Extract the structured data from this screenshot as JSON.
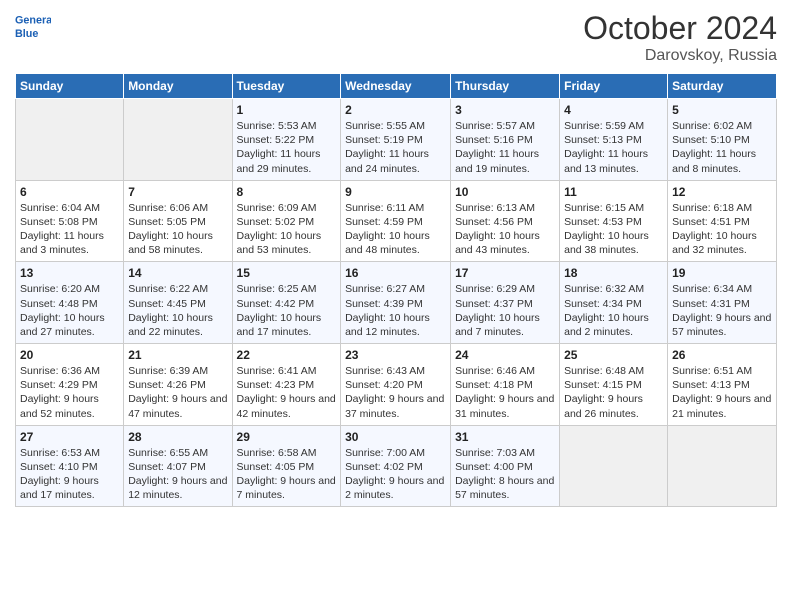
{
  "header": {
    "logo_line1": "General",
    "logo_line2": "Blue",
    "month_year": "October 2024",
    "location": "Darovskoy, Russia"
  },
  "weekdays": [
    "Sunday",
    "Monday",
    "Tuesday",
    "Wednesday",
    "Thursday",
    "Friday",
    "Saturday"
  ],
  "weeks": [
    [
      {
        "day": "",
        "info": ""
      },
      {
        "day": "",
        "info": ""
      },
      {
        "day": "1",
        "info": "Sunrise: 5:53 AM\nSunset: 5:22 PM\nDaylight: 11 hours and 29 minutes."
      },
      {
        "day": "2",
        "info": "Sunrise: 5:55 AM\nSunset: 5:19 PM\nDaylight: 11 hours and 24 minutes."
      },
      {
        "day": "3",
        "info": "Sunrise: 5:57 AM\nSunset: 5:16 PM\nDaylight: 11 hours and 19 minutes."
      },
      {
        "day": "4",
        "info": "Sunrise: 5:59 AM\nSunset: 5:13 PM\nDaylight: 11 hours and 13 minutes."
      },
      {
        "day": "5",
        "info": "Sunrise: 6:02 AM\nSunset: 5:10 PM\nDaylight: 11 hours and 8 minutes."
      }
    ],
    [
      {
        "day": "6",
        "info": "Sunrise: 6:04 AM\nSunset: 5:08 PM\nDaylight: 11 hours and 3 minutes."
      },
      {
        "day": "7",
        "info": "Sunrise: 6:06 AM\nSunset: 5:05 PM\nDaylight: 10 hours and 58 minutes."
      },
      {
        "day": "8",
        "info": "Sunrise: 6:09 AM\nSunset: 5:02 PM\nDaylight: 10 hours and 53 minutes."
      },
      {
        "day": "9",
        "info": "Sunrise: 6:11 AM\nSunset: 4:59 PM\nDaylight: 10 hours and 48 minutes."
      },
      {
        "day": "10",
        "info": "Sunrise: 6:13 AM\nSunset: 4:56 PM\nDaylight: 10 hours and 43 minutes."
      },
      {
        "day": "11",
        "info": "Sunrise: 6:15 AM\nSunset: 4:53 PM\nDaylight: 10 hours and 38 minutes."
      },
      {
        "day": "12",
        "info": "Sunrise: 6:18 AM\nSunset: 4:51 PM\nDaylight: 10 hours and 32 minutes."
      }
    ],
    [
      {
        "day": "13",
        "info": "Sunrise: 6:20 AM\nSunset: 4:48 PM\nDaylight: 10 hours and 27 minutes."
      },
      {
        "day": "14",
        "info": "Sunrise: 6:22 AM\nSunset: 4:45 PM\nDaylight: 10 hours and 22 minutes."
      },
      {
        "day": "15",
        "info": "Sunrise: 6:25 AM\nSunset: 4:42 PM\nDaylight: 10 hours and 17 minutes."
      },
      {
        "day": "16",
        "info": "Sunrise: 6:27 AM\nSunset: 4:39 PM\nDaylight: 10 hours and 12 minutes."
      },
      {
        "day": "17",
        "info": "Sunrise: 6:29 AM\nSunset: 4:37 PM\nDaylight: 10 hours and 7 minutes."
      },
      {
        "day": "18",
        "info": "Sunrise: 6:32 AM\nSunset: 4:34 PM\nDaylight: 10 hours and 2 minutes."
      },
      {
        "day": "19",
        "info": "Sunrise: 6:34 AM\nSunset: 4:31 PM\nDaylight: 9 hours and 57 minutes."
      }
    ],
    [
      {
        "day": "20",
        "info": "Sunrise: 6:36 AM\nSunset: 4:29 PM\nDaylight: 9 hours and 52 minutes."
      },
      {
        "day": "21",
        "info": "Sunrise: 6:39 AM\nSunset: 4:26 PM\nDaylight: 9 hours and 47 minutes."
      },
      {
        "day": "22",
        "info": "Sunrise: 6:41 AM\nSunset: 4:23 PM\nDaylight: 9 hours and 42 minutes."
      },
      {
        "day": "23",
        "info": "Sunrise: 6:43 AM\nSunset: 4:20 PM\nDaylight: 9 hours and 37 minutes."
      },
      {
        "day": "24",
        "info": "Sunrise: 6:46 AM\nSunset: 4:18 PM\nDaylight: 9 hours and 31 minutes."
      },
      {
        "day": "25",
        "info": "Sunrise: 6:48 AM\nSunset: 4:15 PM\nDaylight: 9 hours and 26 minutes."
      },
      {
        "day": "26",
        "info": "Sunrise: 6:51 AM\nSunset: 4:13 PM\nDaylight: 9 hours and 21 minutes."
      }
    ],
    [
      {
        "day": "27",
        "info": "Sunrise: 6:53 AM\nSunset: 4:10 PM\nDaylight: 9 hours and 17 minutes."
      },
      {
        "day": "28",
        "info": "Sunrise: 6:55 AM\nSunset: 4:07 PM\nDaylight: 9 hours and 12 minutes."
      },
      {
        "day": "29",
        "info": "Sunrise: 6:58 AM\nSunset: 4:05 PM\nDaylight: 9 hours and 7 minutes."
      },
      {
        "day": "30",
        "info": "Sunrise: 7:00 AM\nSunset: 4:02 PM\nDaylight: 9 hours and 2 minutes."
      },
      {
        "day": "31",
        "info": "Sunrise: 7:03 AM\nSunset: 4:00 PM\nDaylight: 8 hours and 57 minutes."
      },
      {
        "day": "",
        "info": ""
      },
      {
        "day": "",
        "info": ""
      }
    ]
  ]
}
